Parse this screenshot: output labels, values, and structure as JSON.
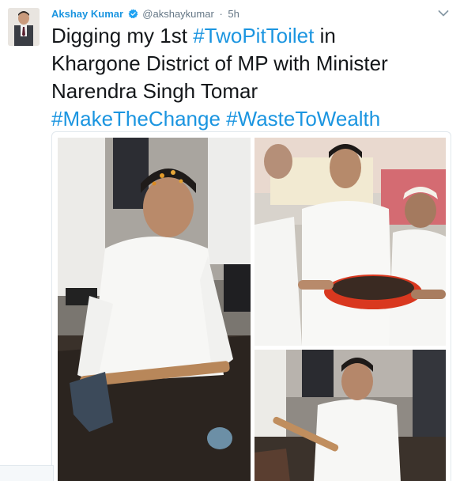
{
  "tweet": {
    "display_name": "Akshay Kumar",
    "handle": "@akshaykumar",
    "separator": "·",
    "time": "5h",
    "text_line1_plain": "Digging my 1st ",
    "text_line1_tag": "#TwoPitToilet",
    "text_line1_end": " in",
    "text_line2": "Khargone District of MP with Minister",
    "text_line3": "Narendra Singh Tomar",
    "hashtag_2": "#MakeTheChange",
    "hashtag_3": "#WasteToWealth"
  },
  "media": {
    "photos": [
      {
        "name": "photo-digging-pit"
      },
      {
        "name": "photo-holding-compost-bowl"
      },
      {
        "name": "photo-digging-closeup"
      }
    ]
  },
  "colors": {
    "link": "#1b95e0",
    "text": "#14171a",
    "muted": "#657786",
    "border": "#e1e8ed"
  }
}
